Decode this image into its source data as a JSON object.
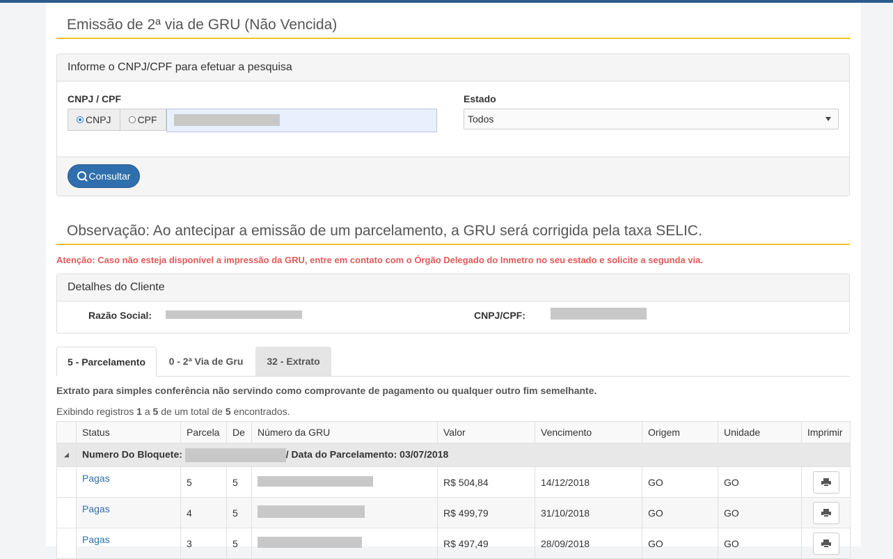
{
  "page": {
    "title": "Emissão de 2ª via de GRU (Não Vencida)"
  },
  "search": {
    "panel_title": "Informe o CNPJ/CPF para efetuar a pesquisa",
    "doc_label": "CNPJ / CPF",
    "radio_cnpj": "CNPJ",
    "radio_cpf": "CPF",
    "selected_radio": "CNPJ",
    "state_label": "Estado",
    "state_value": "Todos",
    "button_label": "Consultar"
  },
  "observation": "Observação: Ao antecipar a emissão de um parcelamento, a GRU será corrigida pela taxa SELIC.",
  "attention": "Atenção: Caso não esteja disponível a impressão da GRU, entre em contato com o Órgão Delegado do Inmetro no seu estado e solicite a segunda via.",
  "client": {
    "panel_title": "Detalhes do Cliente",
    "razao_label": "Razão Social:",
    "cnpj_label": "CNPJ/CPF:"
  },
  "tabs": [
    {
      "label": "5 - Parcelamento",
      "active": true
    },
    {
      "label": "0 - 2ª Via de Gru",
      "active": false
    },
    {
      "label": "32 - Extrato",
      "active": false
    }
  ],
  "disclaimer": "Extrato para simples conferência não servindo como comprovante de pagamento ou qualquer outro fim semelhante.",
  "showing": {
    "prefix": "Exibindo registros",
    "from": "1",
    "a": "a",
    "to": "5",
    "mid": "de um total de",
    "total": "5",
    "suffix": "encontrados."
  },
  "table": {
    "headers": [
      "Status",
      "Parcela",
      "De",
      "Número da GRU",
      "Valor",
      "Vencimento",
      "Origem",
      "Unidade",
      "Imprimir"
    ],
    "group": {
      "label": "Numero Do Bloquete:",
      "date_text": "/ Data do Parcelamento: 03/07/2018"
    },
    "rows": [
      {
        "status": "Pagas",
        "parcela": "5",
        "de": "5",
        "valor": "R$ 504,84",
        "vencimento": "14/12/2018",
        "origem": "GO",
        "unidade": "GO"
      },
      {
        "status": "Pagas",
        "parcela": "4",
        "de": "5",
        "valor": "R$ 499,79",
        "vencimento": "31/10/2018",
        "origem": "GO",
        "unidade": "GO"
      },
      {
        "status": "Pagas",
        "parcela": "3",
        "de": "5",
        "valor": "R$ 497,49",
        "vencimento": "28/09/2018",
        "origem": "GO",
        "unidade": "GO"
      }
    ]
  },
  "colors": {
    "accent_line": "#f2c12e",
    "primary_button": "#2f6fad",
    "attention_text": "#e05a5a",
    "link": "#2f6fad",
    "top_bar": "#2c5b8e"
  },
  "icons": {
    "search": "search-icon",
    "print": "printer-icon",
    "collapse": "caret-down-icon"
  }
}
